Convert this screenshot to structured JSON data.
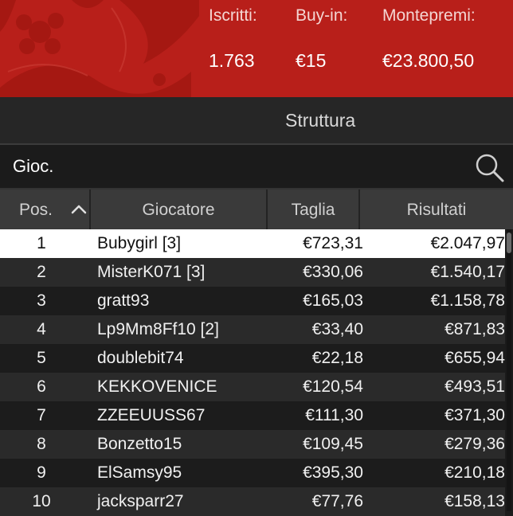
{
  "header": {
    "iscritti_label": "Iscritti:",
    "iscritti_value": "1.763",
    "buyin_label": "Buy-in:",
    "buyin_value": "€15",
    "montepremi_label": "Montepremi:",
    "montepremi_value": "€23.800,50",
    "background_color": "#b81f1a"
  },
  "tabs": {
    "struttura": "Struttura"
  },
  "search": {
    "placeholder": "Gioc."
  },
  "table": {
    "columns": {
      "pos": "Pos.",
      "giocatore": "Giocatore",
      "taglia": "Taglia",
      "risultati": "Risultati"
    },
    "sort_indicator": "chevron-up-icon",
    "rows": [
      {
        "pos": "1",
        "name": "Bubygirl [3]",
        "taglia": "€723,31",
        "risultati": "€2.047,97"
      },
      {
        "pos": "2",
        "name": "MisterK071 [3]",
        "taglia": "€330,06",
        "risultati": "€1.540,17"
      },
      {
        "pos": "3",
        "name": "gratt93",
        "taglia": "€165,03",
        "risultati": "€1.158,78"
      },
      {
        "pos": "4",
        "name": "Lp9Mm8Ff10 [2]",
        "taglia": "€33,40",
        "risultati": "€871,83"
      },
      {
        "pos": "5",
        "name": "doublebit74",
        "taglia": "€22,18",
        "risultati": "€655,94"
      },
      {
        "pos": "6",
        "name": "KEKKOVENICE",
        "taglia": "€120,54",
        "risultati": "€493,51"
      },
      {
        "pos": "7",
        "name": "ZZEEUUSS67",
        "taglia": "€111,30",
        "risultati": "€371,30"
      },
      {
        "pos": "8",
        "name": "Bonzetto15",
        "taglia": "€109,45",
        "risultati": "€279,36"
      },
      {
        "pos": "9",
        "name": "ElSamsy95",
        "taglia": "€395,30",
        "risultati": "€210,18"
      },
      {
        "pos": "10",
        "name": "jacksparr27",
        "taglia": "€77,76",
        "risultati": "€158,13"
      }
    ]
  }
}
